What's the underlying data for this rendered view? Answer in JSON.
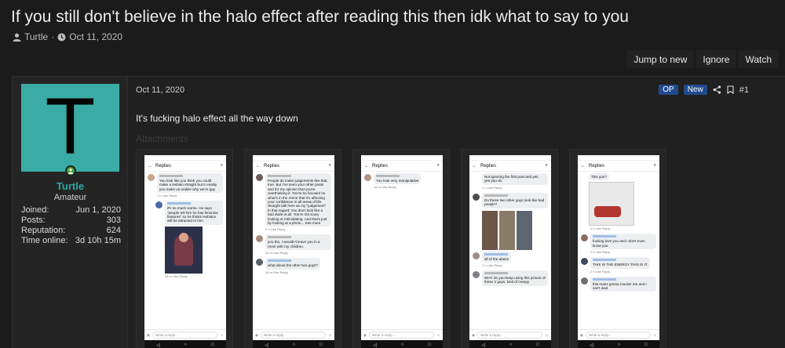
{
  "thread": {
    "title": "If you still don't believe in the halo effect after reading this then idk what to say to you",
    "author": "Turtle",
    "separator": "·",
    "date": "Oct 11, 2020"
  },
  "actions": {
    "jump_to_new": "Jump to new",
    "ignore": "Ignore",
    "watch": "Watch"
  },
  "user": {
    "avatar_letter": "T",
    "name": "Turtle",
    "title": "Amateur",
    "stats": [
      {
        "label": "Joined:",
        "value": "Jun 1, 2020"
      },
      {
        "label": "Posts:",
        "value": "303"
      },
      {
        "label": "Reputation:",
        "value": "624"
      },
      {
        "label": "Time online:",
        "value": "3d 10h 15m"
      }
    ]
  },
  "post": {
    "date": "Oct 11, 2020",
    "badge_op": "OP",
    "badge_new": "New",
    "number": "#1",
    "text": "It's fucking halo effect all the way down",
    "attachments_label": "Attachments"
  },
  "screens": {
    "replies_label": "Replies",
    "write_reply": "Write a reply...",
    "s1": {
      "c1": "You look like you think you could make a lesbian straight but in reality you make us realize why we're gay",
      "c1_meta": "1 h   Like   Reply",
      "c2": "it's so much worse. He says \"people tell him he has feminine features\" so he thinks lesbians will be attracted to him.",
      "c3_meta": "38 m   Like   Reply"
    },
    "s2": {
      "c1": "People do make judgements like that, true. But I've seen your other posts and it's my opinion that you're overthinking it. You're so focused on what's in the mirror that it's affecting your confidence in all areas of life. Straight talk here as my \"judgement\" in that regard: You don't look like a bad dude at all. You're not scary looking or intimidating. And that's just by looking at a photo... See more",
      "c1_meta": "2 h   Like   Reply",
      "c2": "you tho, I wouldn't leave you in a room with my children.",
      "c2_meta": "41 m   Like   Reply",
      "c3": "what about the other two guys?",
      "c3_meta": "16 m   Like   Reply"
    },
    "s3": {
      "c1": "You look very manipulative",
      "c1_meta": "16 m   Like   Reply"
    },
    "s4": {
      "c0": "Not ignoring the first post and yes, yes you do",
      "c0_meta": "1 h   Like   Reply",
      "c1": "Do these two other guys look like bad people?",
      "c2": "all of the above",
      "c2_meta": "1 h   Like   Reply",
      "c3": "WHY do you keep using this picture of these 2 guys. kind of creepy"
    },
    "s5": {
      "c0": "This you?",
      "c0_meta": "2 h   Like   Reply",
      "c1": "fucking love you and I don't even know you",
      "c1_meta": "2 h   Like   Reply",
      "c2": "THIS IS THE ENERGY THIS IS IT",
      "c2_meta": "2 h   Like   Reply",
      "c3": "this mans gonna murder me and I can't wait"
    }
  },
  "colors": {
    "background": "#1b1b1b",
    "accent": "#2fa6a0",
    "avatar_bg": "#3aaca5",
    "badge": "#214a8c",
    "online": "#4a9d3c"
  }
}
